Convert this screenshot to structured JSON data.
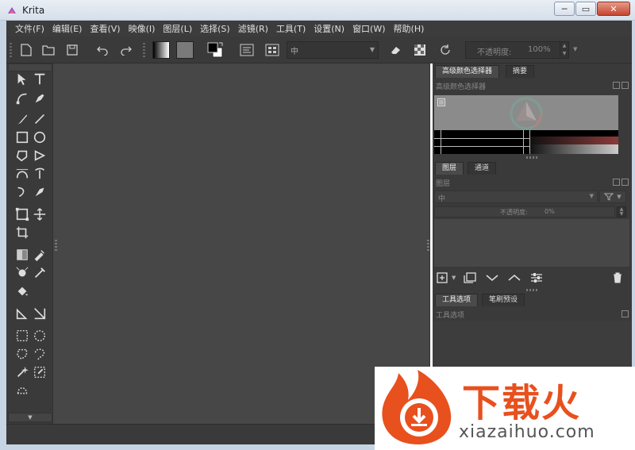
{
  "window": {
    "title": "Krita",
    "minimize": "─",
    "maximize": "▭",
    "close": "✕"
  },
  "menubar": {
    "items": [
      {
        "label": "文件(F)"
      },
      {
        "label": "编辑(E)"
      },
      {
        "label": "查看(V)"
      },
      {
        "label": "映像(I)"
      },
      {
        "label": "图层(L)"
      },
      {
        "label": "选择(S)"
      },
      {
        "label": "滤镜(R)"
      },
      {
        "label": "工具(T)"
      },
      {
        "label": "设置(N)"
      },
      {
        "label": "窗口(W)"
      },
      {
        "label": "帮助(H)"
      }
    ]
  },
  "toolbar": {
    "blend_mode": "中",
    "opacity_label": "不透明度:",
    "opacity_value": "100%"
  },
  "advanced_color": {
    "tab_label": "高级颜色选择器",
    "tab2_label": "摘要",
    "subtitle": "高级颜色选择器"
  },
  "layers": {
    "tab_label": "图层",
    "tab2_label": "通道",
    "subtitle": "图层",
    "blend_mode": "中",
    "opacity_label": "不透明度:",
    "opacity_value": "0%"
  },
  "tool_options": {
    "tab_label": "工具选项",
    "tab2_label": "笔刷预设",
    "subtitle": "工具选项"
  },
  "watermark": {
    "brand": "下载火",
    "domain": "xiazaihuo.com"
  },
  "colors": {
    "bg_dark": "#3a3a3a",
    "canvas": "#474747",
    "accent": "#e8501e"
  }
}
